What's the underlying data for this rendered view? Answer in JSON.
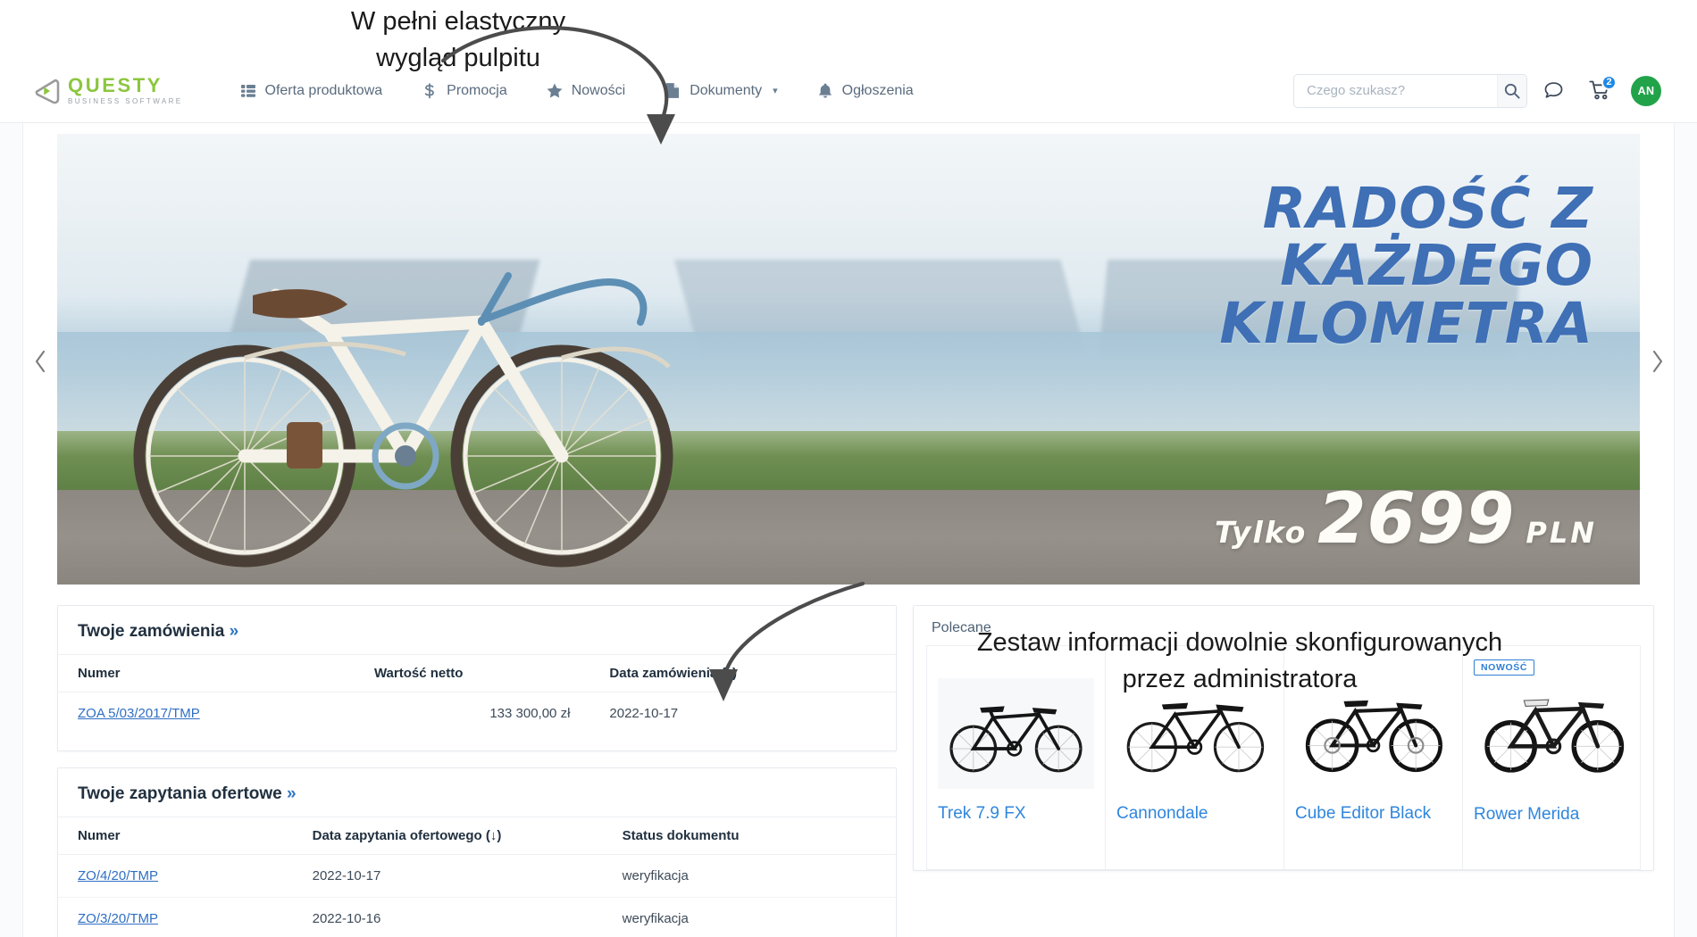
{
  "annotations": {
    "top": "W pełni elastyczny\nwygląd pulpitu",
    "bottom": "Zestaw informacji dowolnie skonfigurowanych\nprzez administratora"
  },
  "brand": {
    "name": "QUESTY",
    "tagline": "BUSINESS SOFTWARE",
    "logo_color": "#8cc63f",
    "mark_color": "#9a9a9a"
  },
  "nav": {
    "items": [
      {
        "label": "Oferta produktowa",
        "icon": "list-grid-icon",
        "has_chevron": false
      },
      {
        "label": "Promocja",
        "icon": "dollar-icon",
        "has_chevron": false
      },
      {
        "label": "Nowości",
        "icon": "star-icon",
        "has_chevron": false
      },
      {
        "label": "Dokumenty",
        "icon": "document-icon",
        "has_chevron": true
      },
      {
        "label": "Ogłoszenia",
        "icon": "bell-icon",
        "has_chevron": false
      }
    ]
  },
  "header": {
    "search": {
      "placeholder": "Czego szukasz?",
      "value": "",
      "icon": "search-icon"
    },
    "chat_icon": "chat-bubble-icon",
    "cart_icon": "shopping-cart-icon",
    "cart_count": "2",
    "cart_badge_color": "#1e88e5",
    "avatar_initials": "AN",
    "avatar_color": "#22a34a"
  },
  "carousel": {
    "prev_icon": "chevron-left-icon",
    "next_icon": "chevron-right-icon",
    "slide": {
      "headline": "Radość z każdego\nkilometra",
      "headline_color": "#3f6fb5",
      "price_prefix": "Tylko",
      "price_value": "2699",
      "price_currency": "PLN"
    }
  },
  "orders_panel": {
    "title": "Twoje zamówienia",
    "title_arrows": "»",
    "columns": [
      "Numer",
      "Wartość netto",
      "Data zamówienia (↓)"
    ],
    "rows": [
      {
        "numer": "ZOA 5/03/2017/TMP",
        "wartosc": "133 300,00 zł",
        "data": "2022-10-17"
      }
    ]
  },
  "offers_panel": {
    "title": "Twoje zapytania ofertowe",
    "title_arrows": "»",
    "columns": [
      "Numer",
      "Data zapytania ofertowego (↓)",
      "Status dokumentu"
    ],
    "rows": [
      {
        "numer": "ZO/4/20/TMP",
        "data": "2022-10-17",
        "status": "weryfikacja"
      },
      {
        "numer": "ZO/3/20/TMP",
        "data": "2022-10-16",
        "status": "weryfikacja"
      }
    ]
  },
  "recommended": {
    "heading": "Polecane",
    "products": [
      {
        "name": "Trek 7.9 FX",
        "badge": ""
      },
      {
        "name": "Cannondale",
        "badge": ""
      },
      {
        "name": "Cube Editor Black",
        "badge": ""
      },
      {
        "name": "Rower Merida",
        "badge": "NOWOŚĆ"
      }
    ]
  }
}
